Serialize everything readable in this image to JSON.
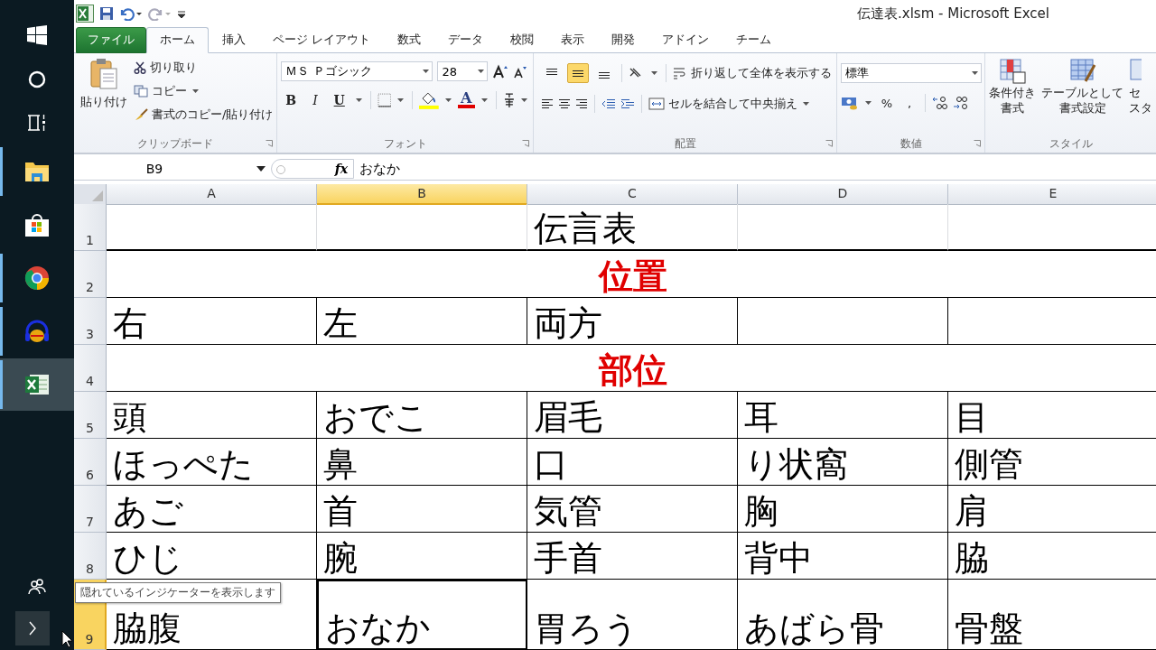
{
  "taskbar": {
    "apps": [
      {
        "kind": "explorer",
        "running": true,
        "selected": false
      },
      {
        "kind": "store",
        "running": false,
        "selected": false
      },
      {
        "kind": "chrome",
        "running": true,
        "selected": false
      },
      {
        "kind": "audio",
        "running": true,
        "selected": false
      },
      {
        "kind": "excel",
        "running": true,
        "selected": true
      }
    ],
    "tooltip": "隠れているインジケーターを表示します"
  },
  "window": {
    "title": "伝達表.xlsm - Microsoft Excel"
  },
  "tabs": [
    {
      "label": "ファイル",
      "kind": "file",
      "selected": false
    },
    {
      "label": "ホーム",
      "kind": "tab",
      "selected": true
    },
    {
      "label": "挿入",
      "kind": "tab",
      "selected": false
    },
    {
      "label": "ページ レイアウト",
      "kind": "tab",
      "selected": false
    },
    {
      "label": "数式",
      "kind": "tab",
      "selected": false
    },
    {
      "label": "データ",
      "kind": "tab",
      "selected": false
    },
    {
      "label": "校閲",
      "kind": "tab",
      "selected": false
    },
    {
      "label": "表示",
      "kind": "tab",
      "selected": false
    },
    {
      "label": "開発",
      "kind": "tab",
      "selected": false
    },
    {
      "label": "アドイン",
      "kind": "tab",
      "selected": false
    },
    {
      "label": "チーム",
      "kind": "tab",
      "selected": false
    }
  ],
  "ribbon": {
    "clipboard": {
      "label": "クリップボード",
      "paste": "貼り付け",
      "cut": "切り取り",
      "copy": "コピー",
      "format_painter": "書式のコピー/貼り付け"
    },
    "font": {
      "label": "フォント",
      "font_name": "ＭＳ Ｐゴシック",
      "font_size": "28",
      "bold": "B",
      "italic": "I",
      "underline": "U",
      "font_color": "A"
    },
    "alignment": {
      "label": "配置",
      "vertical": [
        {
          "kind": "top",
          "selected": false
        },
        {
          "kind": "middle",
          "selected": true
        },
        {
          "kind": "bottom",
          "selected": false
        }
      ],
      "wrap": "折り返して全体を表示する",
      "merge": "セルを結合して中央揃え"
    },
    "number": {
      "label": "数値",
      "format": "標準",
      "percent": "%",
      "comma": ","
    },
    "styles": {
      "label": "スタイル",
      "conditional": [
        "条件付き",
        "書式"
      ],
      "table": [
        "テーブルとして",
        "書式設定"
      ],
      "cell_styles": [
        "セ",
        "スタ"
      ]
    }
  },
  "formula_bar": {
    "name_box": "B9",
    "fx": "fx",
    "value": "おなか"
  },
  "sheet": {
    "columns": [
      {
        "label": "A",
        "selected": false
      },
      {
        "label": "B",
        "selected": true
      },
      {
        "label": "C",
        "selected": false
      },
      {
        "label": "D",
        "selected": false
      },
      {
        "label": "E",
        "selected": false
      }
    ],
    "rows": [
      {
        "label": "1",
        "selected": false,
        "kind": "title",
        "cells": [
          null,
          null,
          "伝言表",
          null,
          null
        ]
      },
      {
        "label": "2",
        "selected": false,
        "kind": "heading",
        "text": "位置"
      },
      {
        "label": "3",
        "selected": false,
        "kind": "cells",
        "cells": [
          "右",
          "左",
          "両方",
          null,
          null
        ]
      },
      {
        "label": "4",
        "selected": false,
        "kind": "heading",
        "text": "部位"
      },
      {
        "label": "5",
        "selected": false,
        "kind": "cells",
        "cells": [
          "頭",
          "おでこ",
          "眉毛",
          "耳",
          "目"
        ]
      },
      {
        "label": "6",
        "selected": false,
        "kind": "cells",
        "cells": [
          "ほっぺた",
          "鼻",
          "口",
          "り状窩",
          "側管"
        ]
      },
      {
        "label": "7",
        "selected": false,
        "kind": "cells",
        "cells": [
          "あご",
          "首",
          "気管",
          "胸",
          "肩"
        ]
      },
      {
        "label": "8",
        "selected": false,
        "kind": "cells",
        "cells": [
          "ひじ",
          "腕",
          "手首",
          "背中",
          "脇"
        ]
      },
      {
        "label": "9",
        "selected": true,
        "kind": "cells",
        "cells": [
          "脇腹",
          "おなか",
          "胃ろう",
          "あばら骨",
          "骨盤"
        ]
      }
    ]
  }
}
